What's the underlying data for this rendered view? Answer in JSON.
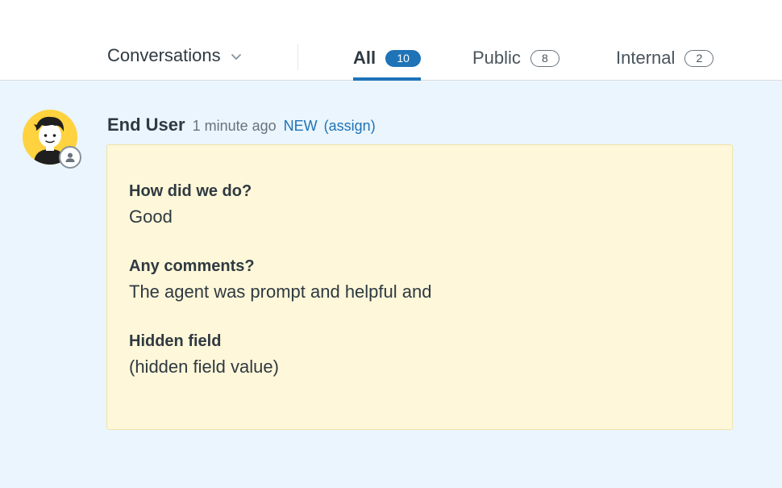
{
  "header": {
    "dropdown_label": "Conversations",
    "tabs": [
      {
        "label": "All",
        "count": "10"
      },
      {
        "label": "Public",
        "count": "8"
      },
      {
        "label": "Internal",
        "count": "2"
      }
    ]
  },
  "message": {
    "author": "End User",
    "time": "1 minute ago",
    "status": "NEW",
    "assign": "(assign)",
    "fields": [
      {
        "question": "How did we do?",
        "answer": "Good"
      },
      {
        "question": "Any comments?",
        "answer": "The agent was prompt and helpful and"
      },
      {
        "question": "Hidden field",
        "answer": "(hidden field value)"
      }
    ]
  },
  "colors": {
    "accent": "#1f73b7",
    "background": "#eaf5fd",
    "card_background": "#fef7d9",
    "avatar_yellow": "#ffd23f"
  }
}
